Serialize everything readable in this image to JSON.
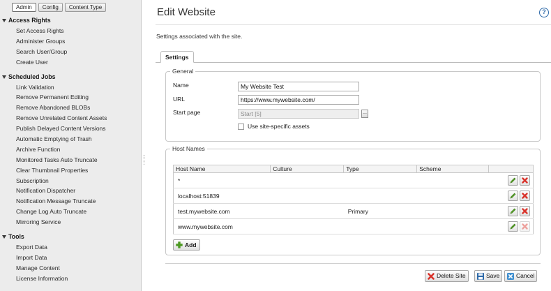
{
  "sidebar": {
    "tabs": [
      {
        "label": "Admin",
        "active": true
      },
      {
        "label": "Config",
        "active": false
      },
      {
        "label": "Content Type",
        "active": false
      }
    ],
    "groups": [
      {
        "title": "Access Rights",
        "items": [
          "Set Access Rights",
          "Administer Groups",
          "Search User/Group",
          "Create User"
        ]
      },
      {
        "title": "Scheduled Jobs",
        "items": [
          "Link Validation",
          "Remove Permanent Editing",
          "Remove Abandoned BLOBs",
          "Remove Unrelated Content Assets",
          "Publish Delayed Content Versions",
          "Automatic Emptying of Trash",
          "Archive Function",
          "Monitored Tasks Auto Truncate",
          "Clear Thumbnail Properties",
          "Subscription",
          "Notification Dispatcher",
          "Notification Message Truncate",
          "Change Log Auto Truncate",
          "Mirroring Service"
        ]
      },
      {
        "title": "Tools",
        "items": [
          "Export Data",
          "Import Data",
          "Manage Content",
          "License Information"
        ]
      }
    ]
  },
  "main": {
    "title": "Edit Website",
    "help_icon": "?",
    "subtitle": "Settings associated with the site.",
    "tab_label": "Settings",
    "general": {
      "legend": "General",
      "name_label": "Name",
      "name_value": "My Website Test",
      "url_label": "URL",
      "url_value": "https://www.mywebsite.com/",
      "start_page_label": "Start page",
      "start_page_value": "Start [5]",
      "browse_label": "...",
      "site_assets_label": "Use site-specific assets",
      "site_assets_checked": false
    },
    "host_names": {
      "legend": "Host Names",
      "columns": [
        "Host Name",
        "Culture",
        "Type",
        "Scheme"
      ],
      "rows": [
        {
          "host": "*",
          "culture": "",
          "type": "",
          "scheme": "",
          "delete_enabled": true
        },
        {
          "host": "localhost:51839",
          "culture": "",
          "type": "",
          "scheme": "",
          "delete_enabled": true
        },
        {
          "host": "test.mywebsite.com",
          "culture": "",
          "type": "Primary",
          "scheme": "",
          "delete_enabled": true
        },
        {
          "host": "www.mywebsite.com",
          "culture": "",
          "type": "",
          "scheme": "",
          "delete_enabled": false
        }
      ],
      "add_label": "Add"
    },
    "footer": {
      "delete_label": "Delete Site",
      "save_label": "Save",
      "cancel_label": "Cancel"
    }
  },
  "colors": {
    "accent": "#2e6aa9",
    "edit_green": "#5aa02c",
    "delete_red": "#d9332b",
    "sidebar_bg": "#ececec"
  },
  "icons": {
    "edit": "pencil-icon",
    "delete": "red-x-icon",
    "add": "green-plus-icon",
    "save": "floppy-disk-icon",
    "cancel": "cancel-icon",
    "help": "help-icon",
    "group_toggle": "triangle-down-icon"
  }
}
